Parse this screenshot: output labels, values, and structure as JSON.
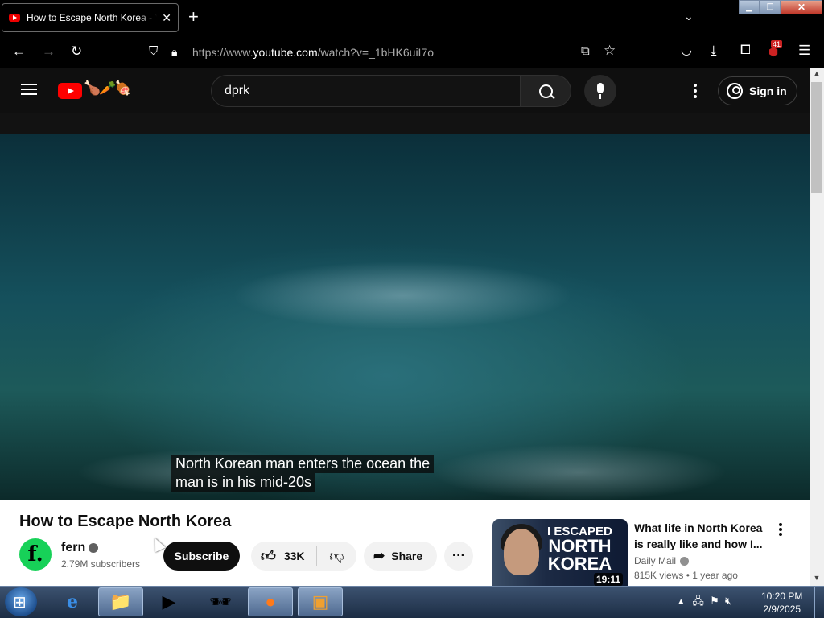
{
  "browser": {
    "tab_title": "How to Escape North Korea - YouTube",
    "url_prefix": "https://www.",
    "url_domain": "youtube.com",
    "url_path": "/watch?v=_1bHK6uiI7o",
    "extension_badge": "41"
  },
  "youtube": {
    "search_value": "dprk",
    "sign_in_label": "Sign in",
    "doodle": "🍗🥕🍖"
  },
  "video": {
    "caption_line1": "North Korean man enters the ocean the",
    "caption_line2": "man is in his mid-20s",
    "title": "How to Escape North Korea",
    "channel_initial": "f.",
    "channel_name": "fern",
    "subscribers": "2.79M subscribers",
    "subscribe_label": "Subscribe",
    "likes": "33K",
    "share_label": "Share",
    "more_label": "···"
  },
  "recommended": {
    "thumb_line1": "I ESCAPED",
    "thumb_line2": "NORTH",
    "thumb_line3": "KOREA",
    "duration": "19:11",
    "title": "What life in North Korea is really like and how I...",
    "channel": "Daily Mail",
    "views": "815K views",
    "age": "1 year ago"
  },
  "taskbar": {
    "time": "10:20 PM",
    "date": "2/9/2025"
  }
}
